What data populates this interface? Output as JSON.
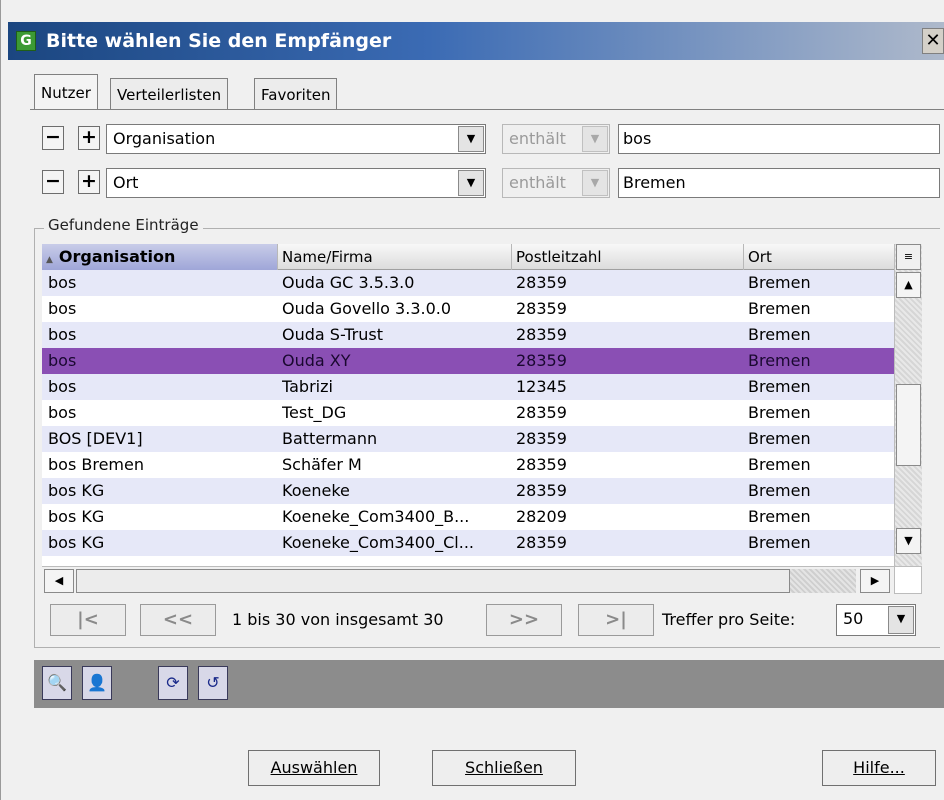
{
  "window": {
    "title": "Bitte wählen Sie den Empfänger",
    "app_icon_letter": "G",
    "close_glyph": "✕"
  },
  "tabs": [
    {
      "label": "Nutzer",
      "active": true
    },
    {
      "label": "Verteilerlisten",
      "active": false
    },
    {
      "label": "Favoriten",
      "active": false
    }
  ],
  "filters": [
    {
      "minus": "−",
      "plus": "+",
      "field": "Organisation",
      "operator": "enthält",
      "value": "bos"
    },
    {
      "minus": "−",
      "plus": "+",
      "field": "Ort",
      "operator": "enthält",
      "value": "Bremen"
    }
  ],
  "results": {
    "group_label": "Gefundene Einträge",
    "columns": [
      "Organisation",
      "Name/Firma",
      "Postleitzahl",
      "Ort"
    ],
    "sorted_column": "Organisation",
    "selected_row_index": 3,
    "rows": [
      [
        "bos",
        "Ouda GC 3.5.3.0",
        "28359",
        "Bremen"
      ],
      [
        "bos",
        "Ouda Govello 3.3.0.0",
        "28359",
        "Bremen"
      ],
      [
        "bos",
        "Ouda S-Trust",
        "28359",
        "Bremen"
      ],
      [
        "bos",
        "Ouda XY",
        "28359",
        "Bremen"
      ],
      [
        "bos",
        "Tabrizi",
        "12345",
        "Bremen"
      ],
      [
        "bos",
        "Test_DG",
        "28359",
        "Bremen"
      ],
      [
        "BOS [DEV1]",
        "Battermann",
        "28359",
        "Bremen"
      ],
      [
        "bos Bremen",
        "Schäfer M",
        "28359",
        "Bremen"
      ],
      [
        "bos KG",
        "Koeneke",
        "28359",
        "Bremen"
      ],
      [
        "bos KG",
        "Koeneke_Com3400_B...",
        "28209",
        "Bremen"
      ],
      [
        "bos KG",
        "Koeneke_Com3400_Cl...",
        "28359",
        "Bremen"
      ]
    ]
  },
  "pager": {
    "first": "|<",
    "prev": "<<",
    "info": "1 bis 30 von insgesamt 30",
    "next": ">>",
    "last": ">|",
    "hits_label": "Treffer pro Seite:",
    "hits_value": "50"
  },
  "toolbar": {
    "icons": [
      "search-user-icon",
      "add-user-icon",
      "refresh-icon",
      "undo-icon"
    ]
  },
  "buttons": {
    "select": "Auswählen",
    "close": "Schließen",
    "help": "Hilfe..."
  }
}
